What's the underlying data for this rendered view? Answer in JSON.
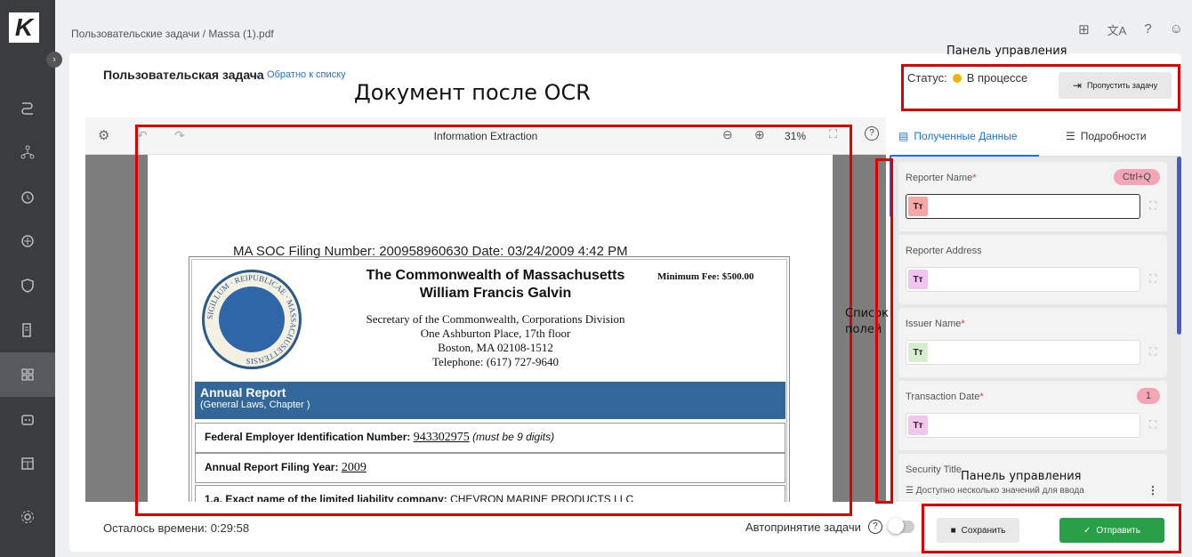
{
  "breadcrumb": {
    "text": "Пользовательские задачи  /  Massa (1).pdf"
  },
  "header": {
    "title": "Пользовательская задача",
    "back_link": "← Обратно к списку"
  },
  "status": {
    "label": "Статус:",
    "value": "В процессе",
    "color": "#f0b400"
  },
  "skip_button": "Пропустить задачу",
  "viewer": {
    "title": "Information Extraction",
    "zoom": "31%"
  },
  "document": {
    "filing": "MA SOC    Filing Number: 200958960630    Date: 03/24/2009 4:42 PM",
    "heading1": "The Commonwealth of Massachusetts",
    "heading2": "William Francis Galvin",
    "fee": "Minimum Fee: $500.00",
    "addr1": "Secretary of the Commonwealth, Corporations Division",
    "addr2": "One Ashburton Place, 17th floor",
    "addr3": "Boston, MA 02108-1512",
    "addr4": "Telephone: (617) 727-9640",
    "seal_text": "SIGILLUM · REIPUBLICAE · MASSACHUSETTENSIS",
    "band_title": "Annual Report",
    "band_sub": "(General Laws, Chapter )",
    "fein_label": "Federal Employer Identification Number:",
    "fein_value": "943302975",
    "fein_note": "(must be 9 digits)",
    "year_label": "Annual Report Filing Year:",
    "year_value": "2009",
    "name_label": "1.a. Exact name of the limited liability company:",
    "name_value": "CHEVRON MARINE PRODUCTS LLC"
  },
  "tabs": [
    {
      "label": "Полученные Данные"
    },
    {
      "label": "Подробности"
    }
  ],
  "fields": [
    {
      "label": "Reporter Name",
      "required": "*",
      "badge": "Ctrl+Q",
      "tt": "Tт",
      "tt_color": "#f7a7a7"
    },
    {
      "label": "Reporter Address",
      "required": "",
      "badge": "",
      "tt": "Tт",
      "tt_color": "#f2c4f2"
    },
    {
      "label": "Issuer Name",
      "required": "*",
      "badge": "",
      "tt": "Tт",
      "tt_color": "#d8eed0"
    },
    {
      "label": "Transaction Date",
      "required": "*",
      "badge": "1",
      "tt": "Tт",
      "tt_color": "#f3c6ec"
    },
    {
      "label": "Security Title",
      "required": "",
      "badge": "",
      "multi": "Доступно несколько значений для ввода"
    }
  ],
  "footer": {
    "timer": "Осталось времени: 0:29:58",
    "auto_accept": "Автопринятие задачи",
    "save": "Сохранить",
    "send": "Отправить"
  },
  "annotations": {
    "doc_label": "Документ после OCR",
    "panel_label_top": "Панель управления",
    "panel_label_bottom": "Панель управления",
    "list_label_1": "Список",
    "list_label_2": "полей"
  },
  "colors": {
    "sidebar": "#3a3c40",
    "accent": "#1a73e8",
    "send": "#27a047",
    "annotation": "#e00000",
    "band": "#336699"
  }
}
